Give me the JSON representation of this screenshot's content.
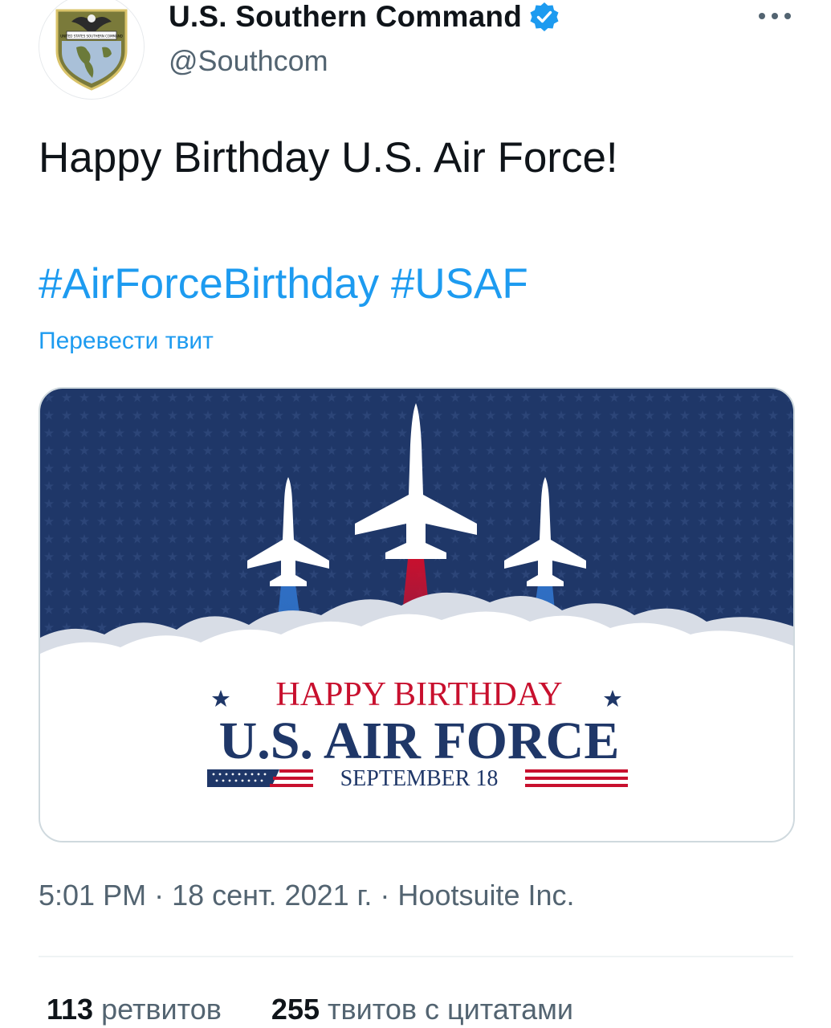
{
  "author": {
    "display_name": "U.S. Southern Command",
    "handle": "@Southcom",
    "verified": true,
    "avatar_badge_text": "UNITED STATES SOUTHERN COMMAND"
  },
  "more_icon": "more-horizontal-icon",
  "tweet": {
    "text": "Happy Birthday U.S. Air Force!",
    "hashtags": [
      "#AirForceBirthday",
      "#USAF"
    ],
    "translate_label": "Перевести твит"
  },
  "media": {
    "line1": "HAPPY BIRTHDAY",
    "line2": "U.S. AIR FORCE",
    "line3": "SEPTEMBER 18",
    "colors": {
      "navy": "#1f3768",
      "red": "#c8102e",
      "blue_trail": "#2f6fc4"
    }
  },
  "meta": {
    "time": "5:01 PM",
    "date": "18 сент. 2021 г.",
    "separator": "·",
    "source": "Hootsuite Inc."
  },
  "stats": {
    "retweets_count": "113",
    "retweets_label": "ретвитов",
    "quotes_count": "255",
    "quotes_label": "твитов с цитатами"
  },
  "colors": {
    "link_blue": "#1d9bf0",
    "secondary_text": "#536471",
    "primary_text": "#0f1419"
  }
}
